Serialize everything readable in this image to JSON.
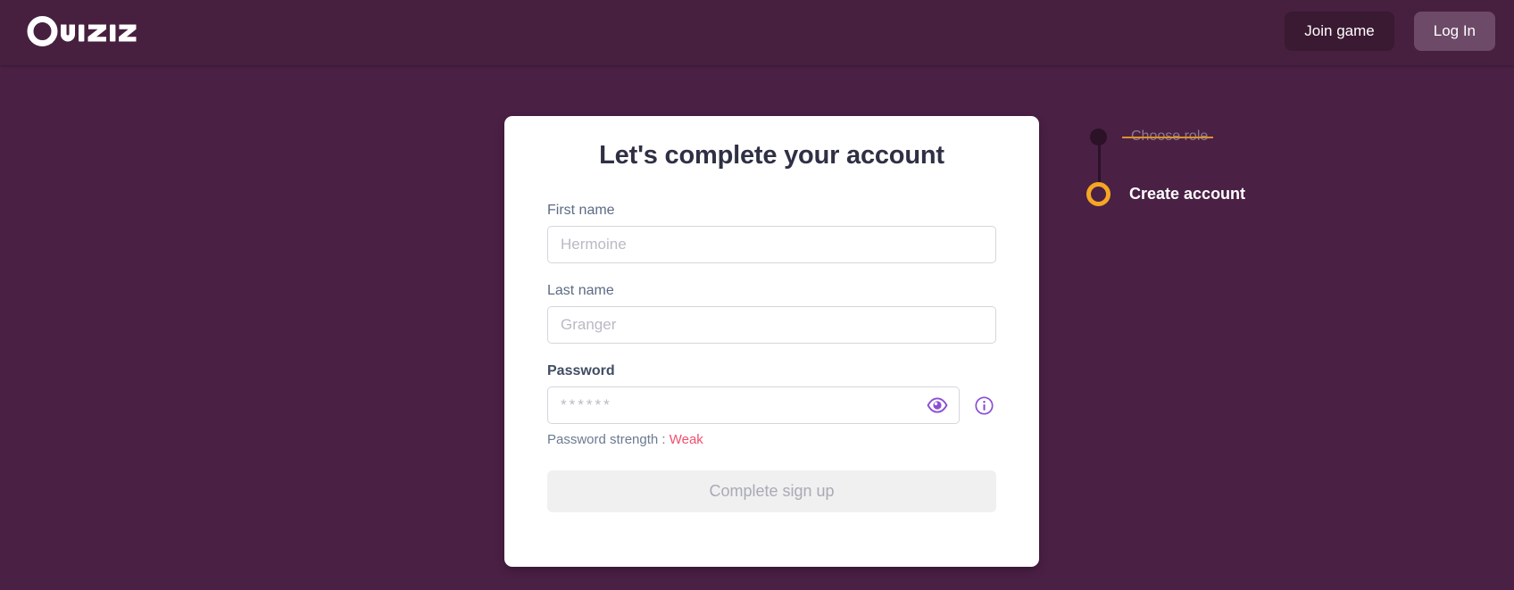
{
  "header": {
    "logo_text": "Quizizz",
    "join_game_label": "Join game",
    "log_in_label": "Log In"
  },
  "card": {
    "title": "Let's complete your account",
    "first_name": {
      "label": "First name",
      "placeholder": "Hermoine",
      "value": ""
    },
    "last_name": {
      "label": "Last name",
      "placeholder": "Granger",
      "value": ""
    },
    "password": {
      "label": "Password",
      "placeholder": "******",
      "value": "",
      "toggle_icon": "eye-icon",
      "info_icon": "info-circle-icon",
      "strength_label": "Password strength : ",
      "strength_value": "Weak"
    },
    "submit_label": "Complete sign up"
  },
  "stepper": {
    "steps": [
      {
        "label": "Choose role",
        "state": "completed"
      },
      {
        "label": "Create account",
        "state": "active"
      }
    ]
  },
  "colors": {
    "background": "#4a2045",
    "header": "#47203f",
    "join_button": "#3a1932",
    "login_button": "#6d4a68",
    "accent_gold": "#f5a623",
    "strength_weak": "#f0506e",
    "title_text": "#2f3044",
    "label_text": "#5c6b84",
    "icon_purple": "#8a4fd4",
    "submit_disabled_bg": "#f0f0f0"
  }
}
